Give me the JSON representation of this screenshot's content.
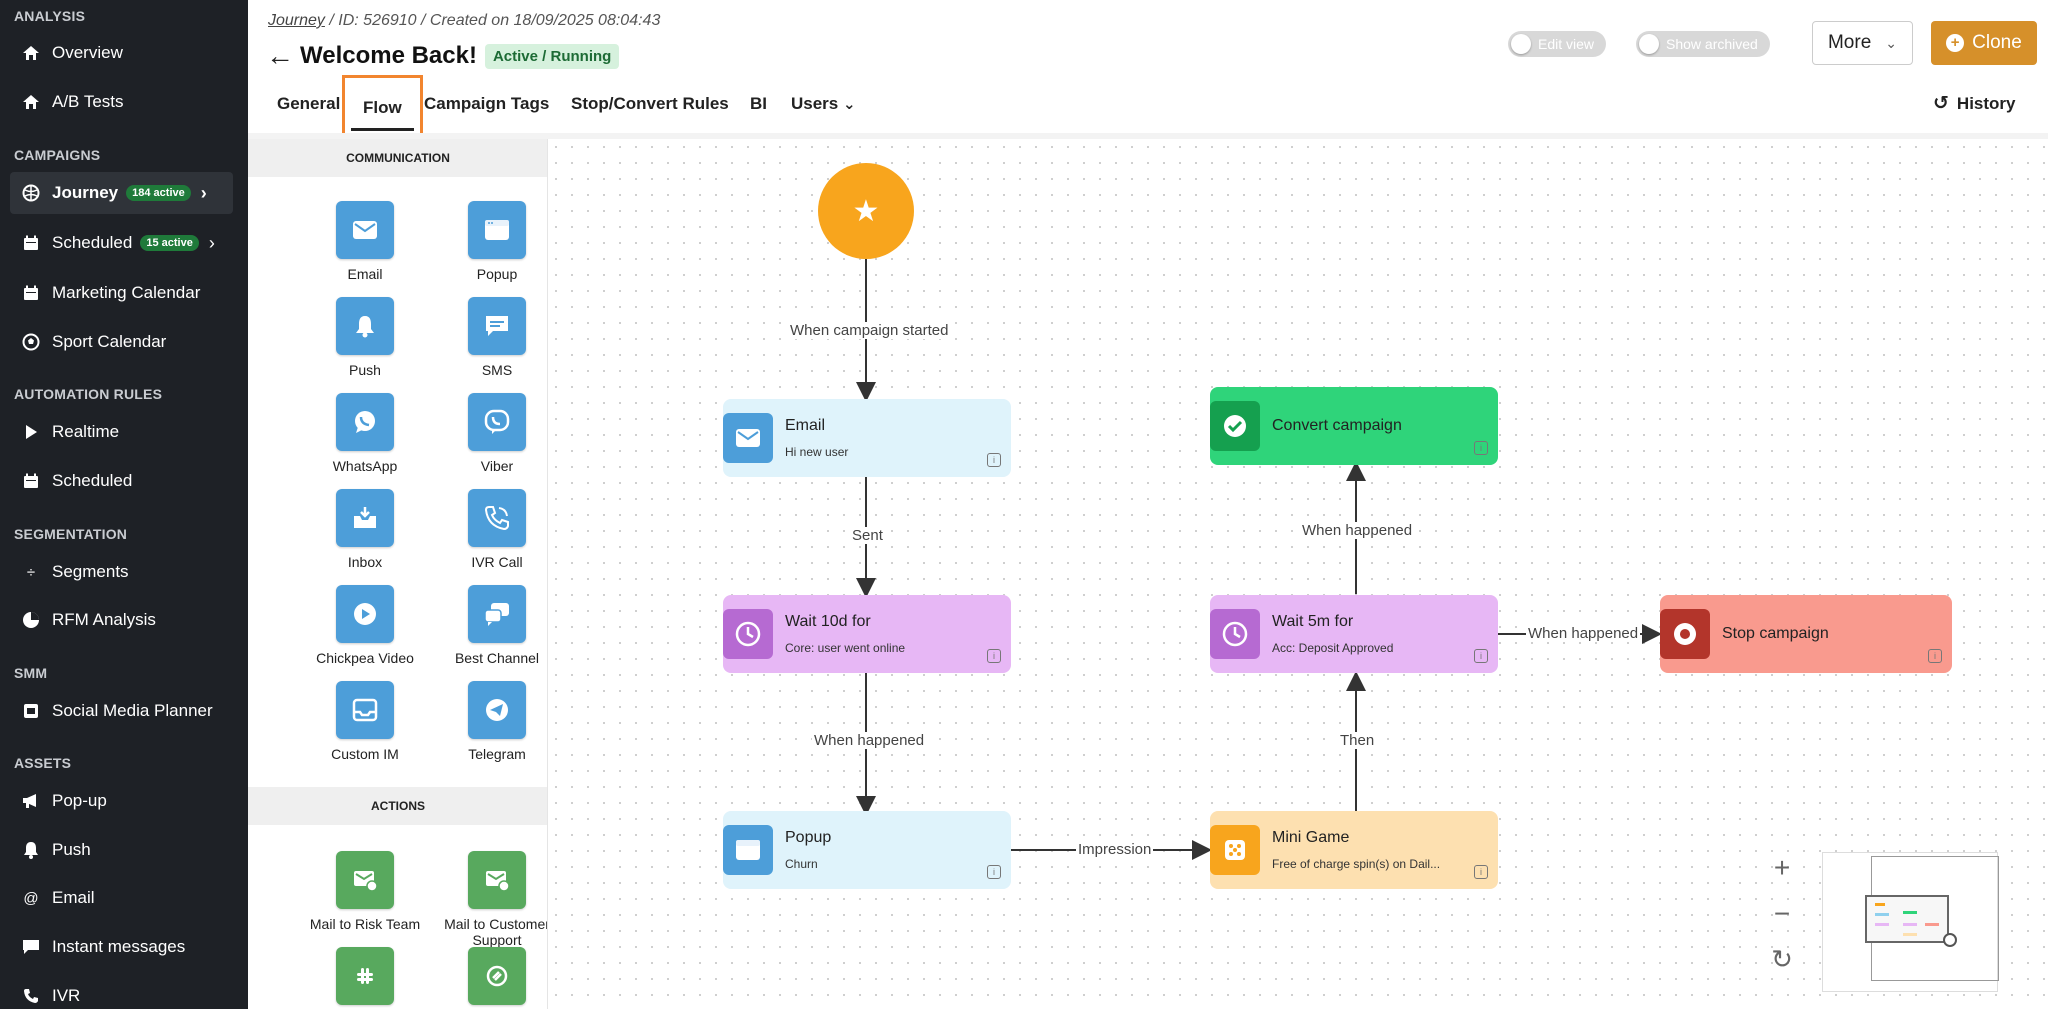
{
  "sidebar": {
    "sections": {
      "analysis": "ANALYSIS",
      "campaigns": "CAMPAIGNS",
      "automation": "AUTOMATION RULES",
      "segmentation": "SEGMENTATION",
      "smm": "SMM",
      "assets": "ASSETS"
    },
    "items": {
      "overview": "Overview",
      "ab_tests": "A/B Tests",
      "journey": "Journey",
      "journey_count": "184 active",
      "scheduled": "Scheduled",
      "scheduled_count": "15 active",
      "marketing_calendar": "Marketing Calendar",
      "sport_calendar": "Sport Calendar",
      "realtime": "Realtime",
      "auto_scheduled": "Scheduled",
      "segments": "Segments",
      "rfm": "RFM Analysis",
      "social_planner": "Social Media Planner",
      "popup": "Pop-up",
      "push": "Push",
      "email": "Email",
      "instant": "Instant messages",
      "ivr": "IVR"
    }
  },
  "header": {
    "crumb_link": "Journey",
    "crumb_id": "ID: 526910",
    "crumb_created": "Created on 18/09/2025 08:04:43",
    "sep": "/",
    "title": "Welcome Back!",
    "status": "Active / Running",
    "edit_view": "Edit view",
    "show_archived": "Show archived",
    "more": "More",
    "clone": "Clone",
    "history": "History"
  },
  "tabs": {
    "general": "General",
    "flow": "Flow",
    "campaign_tags": "Campaign Tags",
    "stop_convert": "Stop/Convert Rules",
    "bi": "BI",
    "users": "Users"
  },
  "palette": {
    "communication": "COMMUNICATION",
    "actions": "ACTIONS",
    "items": {
      "email": "Email",
      "popup": "Popup",
      "push": "Push",
      "sms": "SMS",
      "whatsapp": "WhatsApp",
      "viber": "Viber",
      "inbox": "Inbox",
      "ivr_call": "IVR Call",
      "chickpea": "Chickpea Video",
      "best_channel": "Best Channel",
      "custom_im": "Custom IM",
      "telegram": "Telegram",
      "mail_risk": "Mail to Risk Team",
      "mail_support": "Mail to Customer Support"
    }
  },
  "flow": {
    "edges": {
      "started": "When campaign started",
      "sent": "Sent",
      "happened1": "When happened",
      "impression": "Impression",
      "then": "Then",
      "happened2": "When happened",
      "happened3": "When happened"
    },
    "nodes": {
      "email_title": "Email",
      "email_sub": "Hi new user",
      "wait1_title": "Wait 10d for",
      "wait1_sub": "Core: user went online",
      "popup_title": "Popup",
      "popup_sub": "Churn",
      "minigame_title": "Mini Game",
      "minigame_sub": "Free of charge spin(s) on Dail...",
      "wait2_title": "Wait 5m for",
      "wait2_sub": "Acc: Deposit Approved",
      "convert_title": "Convert campaign",
      "stop_title": "Stop campaign"
    }
  },
  "colors": {
    "accent_orange": "#d6902a",
    "tab_highlight": "#f2852f",
    "start_node": "#f8a51d",
    "channel_node": "#dff3fb",
    "wait_node": "#e7b7f5",
    "game_node": "#fde0b0",
    "convert_node": "#2fd47a",
    "stop_node": "#f99a8e"
  }
}
